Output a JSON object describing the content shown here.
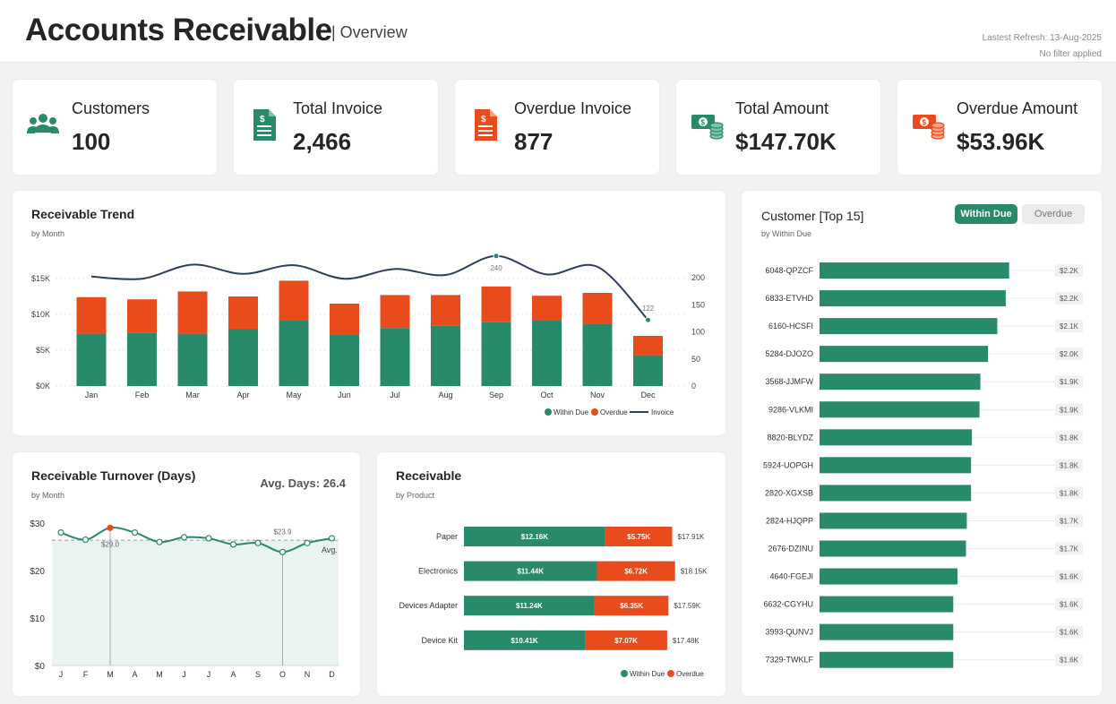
{
  "header": {
    "title": "Accounts Receivable",
    "subtitle": "| Overview",
    "refresh": "Lastest Refresh: 13-Aug-2025",
    "filter": "No filter applied"
  },
  "kpis": [
    {
      "label": "Customers",
      "value": "100",
      "icon": "users-icon",
      "color": "#28896b"
    },
    {
      "label": "Total Invoice",
      "value": "2,466",
      "icon": "invoice-icon",
      "color": "#28896b"
    },
    {
      "label": "Overdue Invoice",
      "value": "877",
      "icon": "invoice-icon",
      "color": "#e84b1c"
    },
    {
      "label": "Total Amount",
      "value": "$147.70K",
      "icon": "money-icon",
      "color": "#28896b"
    },
    {
      "label": "Overdue Amount",
      "value": "$53.96K",
      "icon": "money-icon",
      "color": "#e84b1c"
    }
  ],
  "colors": {
    "within_due": "#28896b",
    "overdue": "#e84b1c",
    "invoice": "#2c3e5c"
  },
  "trend": {
    "title": "Receivable Trend",
    "sub": "by Month"
  },
  "turnover": {
    "title": "Receivable Turnover (Days)",
    "sub": "by Month",
    "avg": "Avg. Days: 26.4"
  },
  "product": {
    "title": "Receivable",
    "sub": "by Product"
  },
  "customer": {
    "title": "Customer [Top 15]",
    "sub": "by Within Due",
    "toggle_within": "Within Due",
    "toggle_overdue": "Overdue"
  },
  "chart_data": [
    {
      "type": "bar",
      "title": "Receivable Trend",
      "subtitle": "by Month",
      "categories": [
        "Jan",
        "Feb",
        "Mar",
        "Apr",
        "May",
        "Jun",
        "Jul",
        "Aug",
        "Sep",
        "Oct",
        "Nov",
        "Dec"
      ],
      "series": [
        {
          "name": "Within Due",
          "values": [
            7300,
            7400,
            7300,
            8000,
            9200,
            7200,
            8100,
            8400,
            8900,
            9200,
            8700,
            4300
          ]
        },
        {
          "name": "Overdue",
          "values": [
            5100,
            4700,
            5900,
            4500,
            5500,
            4300,
            4600,
            4300,
            5000,
            3400,
            4300,
            2700
          ]
        }
      ],
      "line": {
        "name": "Invoice",
        "values": [
          202,
          198,
          224,
          207,
          223,
          198,
          216,
          205,
          240,
          206,
          220,
          122
        ]
      },
      "point_labels": {
        "Sep": "240",
        "Dec": "122"
      },
      "ylim": [
        0,
        15000
      ],
      "yticks": [
        "$0K",
        "$5K",
        "$10K",
        "$15K"
      ],
      "y2lim": [
        0,
        200
      ],
      "y2ticks": [
        "0",
        "50",
        "100",
        "150",
        "200"
      ],
      "legend": "bottom-right"
    },
    {
      "type": "line",
      "title": "Receivable Turnover (Days)",
      "subtitle": "by Month",
      "categories": [
        "J",
        "F",
        "M",
        "A",
        "M",
        "J",
        "J",
        "A",
        "S",
        "O",
        "N",
        "D"
      ],
      "values": [
        28,
        26.5,
        29.0,
        28,
        26,
        27,
        26.8,
        25.5,
        25.8,
        23.9,
        25.8,
        26.8
      ],
      "average": 26.4,
      "avg_label": "Avg.",
      "max_label": "$29.0",
      "min_label": "$23.9",
      "ylim": [
        0,
        30
      ],
      "yticks": [
        "$0",
        "$10",
        "$20",
        "$30"
      ]
    },
    {
      "type": "bar",
      "title": "Receivable",
      "subtitle": "by Product",
      "orientation": "horizontal",
      "categories": [
        "Paper",
        "Electronics",
        "Devices Adapter",
        "Device Kit"
      ],
      "series": [
        {
          "name": "Within Due",
          "values": [
            12160,
            11440,
            11240,
            10410
          ],
          "labels": [
            "$12.16K",
            "$11.44K",
            "$11.24K",
            "$10.41K"
          ]
        },
        {
          "name": "Overdue",
          "values": [
            5750,
            6720,
            6350,
            7070
          ],
          "labels": [
            "$5.75K",
            "$6.72K",
            "$6.35K",
            "$7.07K"
          ]
        }
      ],
      "totals": [
        "$17.91K",
        "$18.15K",
        "$17.59K",
        "$17.48K"
      ],
      "legend": "bottom-right"
    },
    {
      "type": "bar",
      "title": "Customer [Top 15]",
      "subtitle": "by Within Due",
      "orientation": "horizontal",
      "categories": [
        "6048-QPZCF",
        "6833-ETVHD",
        "6160-HCSFI",
        "5284-DJOZO",
        "3568-JJMFW",
        "9286-VLKMI",
        "8820-BLYDZ",
        "5924-UOPGH",
        "2820-XGXSB",
        "2824-HJQPP",
        "2676-DZINU",
        "4640-FGEJI",
        "6632-CGYHU",
        "3993-QUNVJ",
        "7329-TWKLF"
      ],
      "values": [
        2240,
        2200,
        2100,
        1990,
        1900,
        1890,
        1800,
        1790,
        1790,
        1740,
        1730,
        1630,
        1580,
        1580,
        1580
      ],
      "value_labels": [
        "$2.2K",
        "$2.2K",
        "$2.1K",
        "$2.0K",
        "$1.9K",
        "$1.9K",
        "$1.8K",
        "$1.8K",
        "$1.8K",
        "$1.7K",
        "$1.7K",
        "$1.6K",
        "$1.6K",
        "$1.6K",
        "$1.6K"
      ]
    }
  ]
}
